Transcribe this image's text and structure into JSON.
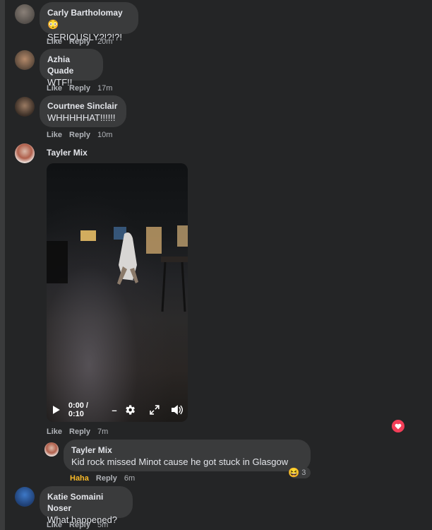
{
  "comments": [
    {
      "name": "Carly Bartholomay",
      "text": "SERIOUSLY?!?!?!",
      "emoji": "😳",
      "like": "Like",
      "reply": "Reply",
      "time": "20m"
    },
    {
      "name": "Azhia Quade",
      "text": "WTF!!",
      "like": "Like",
      "reply": "Reply",
      "time": "17m"
    },
    {
      "name": "Courtnee Sinclair",
      "text": "WHHHHHAT!!!!!!",
      "like": "Like",
      "reply": "Reply",
      "time": "10m"
    }
  ],
  "video_comment": {
    "name": "Tayler Mix",
    "player": {
      "time": "0:00 / 0:10"
    },
    "like": "Like",
    "reply": "Reply",
    "time": "7m"
  },
  "reply_comment": {
    "name": "Tayler Mix",
    "text": "Kid rock missed Minot cause he got stuck in Glasgow",
    "reaction_label": "Haha",
    "reply": "Reply",
    "time": "6m",
    "reaction_emoji": "😆",
    "reaction_count": "3"
  },
  "last_comment": {
    "name": "Katie Somaini Noser",
    "text": "What happened?",
    "like": "Like",
    "reply": "Reply",
    "time": "5m"
  },
  "colors": {
    "bg": "#242526",
    "bubble": "#3a3b3c",
    "meta": "#b0b3b8",
    "haha": "#f7b928",
    "love": "#f33e58"
  }
}
